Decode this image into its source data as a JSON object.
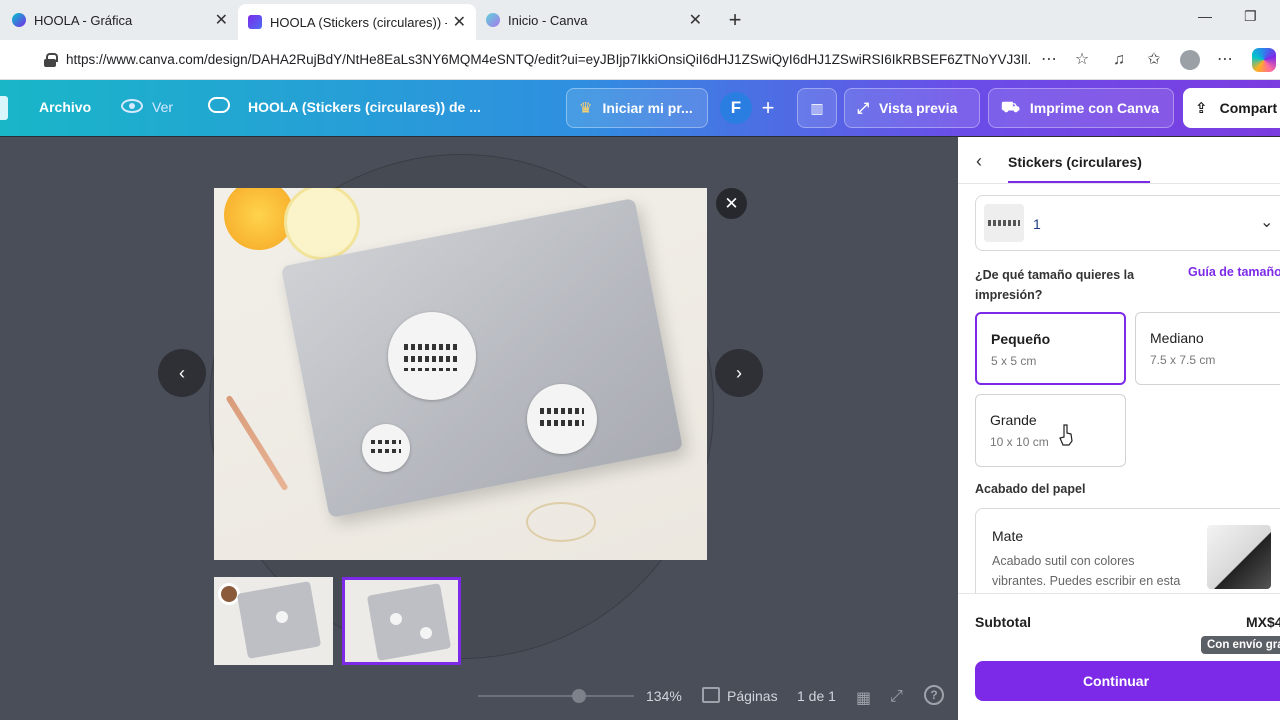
{
  "browser": {
    "tabs": [
      {
        "title": "HOOLA - Gráfica",
        "active": false
      },
      {
        "title": "HOOLA (Stickers (circulares)) - Stic",
        "active": true
      },
      {
        "title": "Inicio - Canva",
        "active": false
      }
    ],
    "url": "https://www.canva.com/design/DAHA2RujBdY/NtHe8EaLs3NY6MQM4eSNTQ/edit?ui=eyJBIjp7IkkiOnsiQiI6dHJ1ZSwiQyI6dHJ1ZSwiRSI6IkRBSEF6ZTNoYVJ3Il..."
  },
  "canva_bar": {
    "file_label": "Archivo",
    "view_label": "Ver",
    "doc_title": "HOOLA (Stickers (circulares)) de ...",
    "trial_label": "Iniciar mi pr...",
    "user_initial": "F",
    "preview_label": "Vista previa",
    "print_label": "Imprime con Canva",
    "share_label": "Compart"
  },
  "preview": {
    "zoom": "134%",
    "pages_label": "Páginas",
    "page_counter": "1 de 1",
    "selected_thumbnail": 2
  },
  "panel": {
    "title": "Stickers (circulares)",
    "quantity": "1",
    "size_question": "¿De qué tamaño quieres la impresión?",
    "size_guide": "Guía de tamaño",
    "sizes": [
      {
        "name": "Pequeño",
        "dims": "5 x 5 cm",
        "selected": true
      },
      {
        "name": "Mediano",
        "dims": "7.5 x 7.5 cm",
        "selected": false
      },
      {
        "name": "Grande",
        "dims": "10 x 10 cm",
        "selected": false
      }
    ],
    "finish_heading": "Acabado del papel",
    "finish": {
      "name": "Mate",
      "description": "Acabado sutil con colores vibrantes. Puedes escribir en esta superficie."
    },
    "subtotal_label": "Subtotal",
    "subtotal_value": "MX$4",
    "shipping_badge": "Con envío gra",
    "continue_label": "Continuar"
  },
  "colors": {
    "accent": "#7d2ae8",
    "stage_bg": "#4a4e58",
    "panel_bg": "#ffffff"
  }
}
